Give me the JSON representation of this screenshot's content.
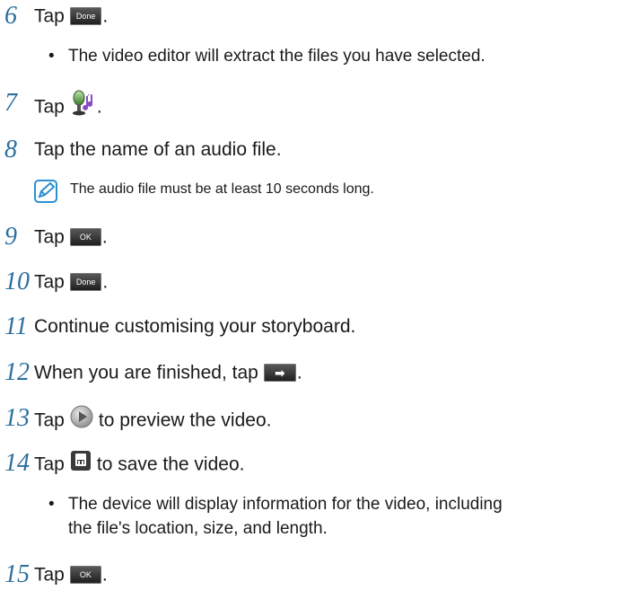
{
  "steps": [
    {
      "num": "6",
      "text": "Tap",
      "after": "."
    },
    {
      "num": "7",
      "text": "Tap",
      "after": "."
    },
    {
      "num": "8",
      "text": "Tap the name of an audio file."
    },
    {
      "num": "9",
      "text": "Tap",
      "after": "."
    },
    {
      "num": "10",
      "text": "Tap",
      "after": "."
    },
    {
      "num": "11",
      "text": "Continue customising your storyboard."
    },
    {
      "num": "12",
      "text": "When you are finished, tap",
      "after": "."
    },
    {
      "num": "13",
      "text": "Tap",
      "after": "to preview the video."
    },
    {
      "num": "14",
      "text": "Tap",
      "after": "to save the video."
    },
    {
      "num": "15",
      "text": "Tap",
      "after": "."
    }
  ],
  "buttons": {
    "done": "Done",
    "ok": "OK",
    "arrow": "➡"
  },
  "bullets": {
    "step6": "The video editor will extract the files you have selected.",
    "step14_line1": "The device will display information for the video, including",
    "step14_line2": "the file's location, size, and length."
  },
  "note": "The audio file must be at least 10 seconds long.",
  "bullet_symbol": "•",
  "colors": {
    "step_number": "#2c6f9e",
    "note_icon": "#2c8fd0",
    "button_bg": "#2a2a2a"
  },
  "icons": [
    "music-mic-icon",
    "play-icon",
    "save-icon",
    "note-pencil-icon"
  ]
}
